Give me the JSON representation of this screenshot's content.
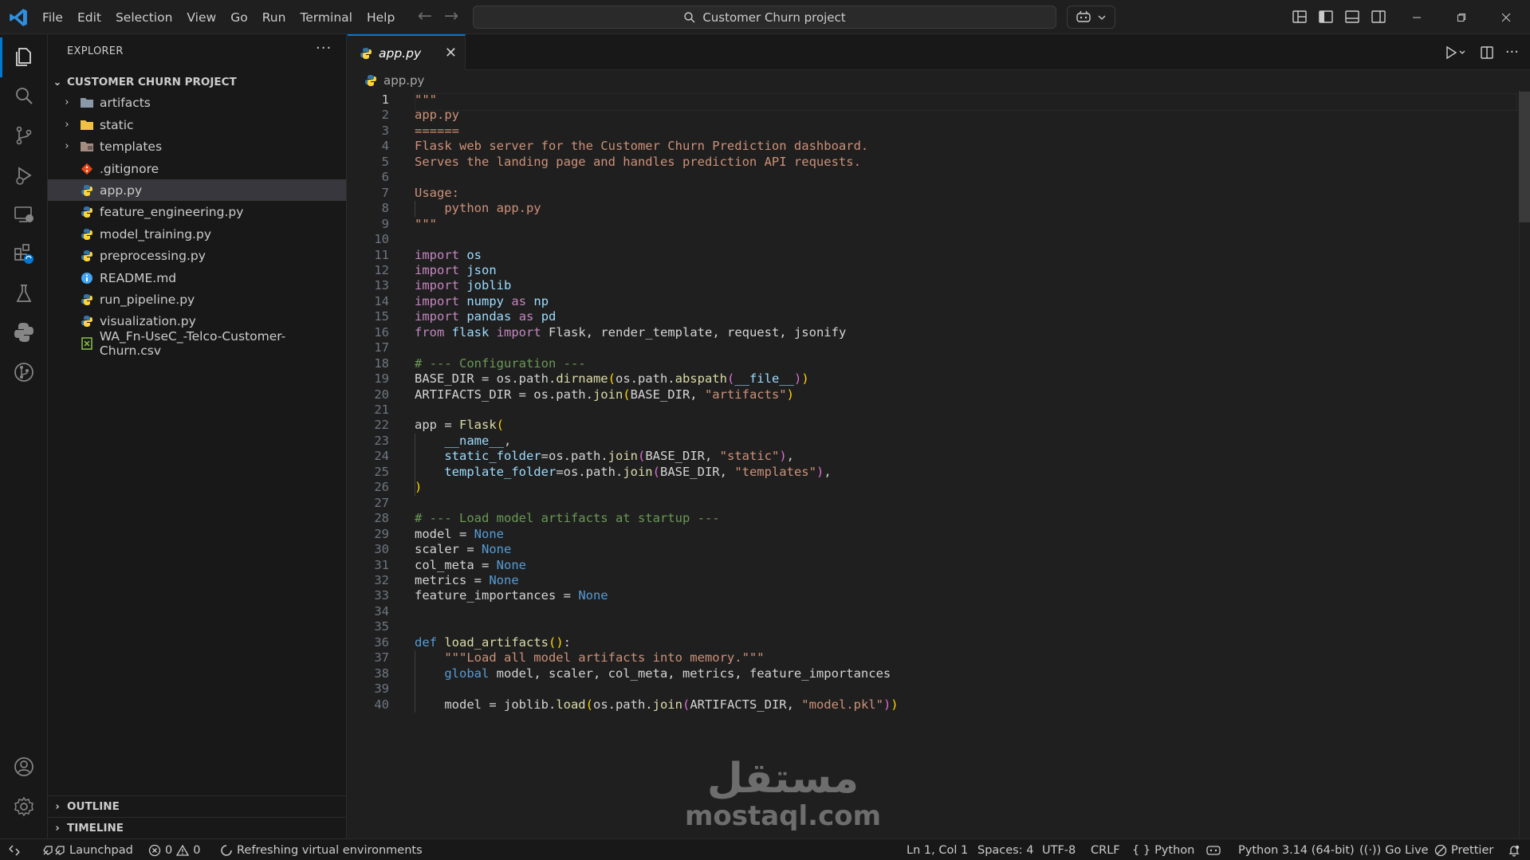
{
  "titlebar": {
    "menu": [
      "File",
      "Edit",
      "Selection",
      "View",
      "Go",
      "Run",
      "Terminal",
      "Help"
    ],
    "search_text": "Customer Churn project"
  },
  "activitybar": {
    "icons": [
      "explorer-icon",
      "search-icon",
      "source-control-icon",
      "run-debug-icon",
      "remote-explorer-icon",
      "extensions-icon",
      "testing-icon",
      "python-icon",
      "git-graph-icon",
      "account-icon",
      "settings-gear-icon"
    ]
  },
  "sidebar": {
    "header": "EXPLORER",
    "more": "···",
    "project": "CUSTOMER CHURN PROJECT",
    "items": [
      {
        "label": "artifacts",
        "type": "folder"
      },
      {
        "label": "static",
        "type": "folder"
      },
      {
        "label": "templates",
        "type": "folder"
      },
      {
        "label": ".gitignore",
        "type": "git"
      },
      {
        "label": "app.py",
        "type": "python",
        "selected": true
      },
      {
        "label": "feature_engineering.py",
        "type": "python"
      },
      {
        "label": "model_training.py",
        "type": "python"
      },
      {
        "label": "preprocessing.py",
        "type": "python"
      },
      {
        "label": "README.md",
        "type": "info"
      },
      {
        "label": "run_pipeline.py",
        "type": "python"
      },
      {
        "label": "visualization.py",
        "type": "python"
      },
      {
        "label": "WA_Fn-UseC_-Telco-Customer-Churn.csv",
        "type": "csv"
      }
    ],
    "outline": "OUTLINE",
    "timeline": "TIMELINE"
  },
  "editor": {
    "tab_label": "app.py",
    "breadcrumb": "app.py",
    "lines": [
      [
        [
          "t-str",
          "\"\"\""
        ]
      ],
      [
        [
          "t-str",
          "app.py"
        ]
      ],
      [
        [
          "t-str",
          "======"
        ]
      ],
      [
        [
          "t-str",
          "Flask web server for the Customer Churn Prediction dashboard."
        ]
      ],
      [
        [
          "t-str",
          "Serves the landing page and handles prediction API requests."
        ]
      ],
      [],
      [
        [
          "t-str",
          "Usage:"
        ]
      ],
      [
        [
          "t-str",
          "    python app.py"
        ]
      ],
      [
        [
          "t-str",
          "\"\"\""
        ]
      ],
      [],
      [
        [
          "t-kw",
          "import"
        ],
        [
          "t-pl",
          " "
        ],
        [
          "t-var",
          "os"
        ]
      ],
      [
        [
          "t-kw",
          "import"
        ],
        [
          "t-pl",
          " "
        ],
        [
          "t-var",
          "json"
        ]
      ],
      [
        [
          "t-kw",
          "import"
        ],
        [
          "t-pl",
          " "
        ],
        [
          "t-var",
          "joblib"
        ]
      ],
      [
        [
          "t-kw",
          "import"
        ],
        [
          "t-pl",
          " "
        ],
        [
          "t-var",
          "numpy"
        ],
        [
          "t-pl",
          " "
        ],
        [
          "t-kw",
          "as"
        ],
        [
          "t-pl",
          " "
        ],
        [
          "t-var",
          "np"
        ]
      ],
      [
        [
          "t-kw",
          "import"
        ],
        [
          "t-pl",
          " "
        ],
        [
          "t-var",
          "pandas"
        ],
        [
          "t-pl",
          " "
        ],
        [
          "t-kw",
          "as"
        ],
        [
          "t-pl",
          " "
        ],
        [
          "t-var",
          "pd"
        ]
      ],
      [
        [
          "t-kw",
          "from"
        ],
        [
          "t-pl",
          " "
        ],
        [
          "t-var",
          "flask"
        ],
        [
          "t-pl",
          " "
        ],
        [
          "t-kw",
          "import"
        ],
        [
          "t-pl",
          " Flask, render_template, request, jsonify"
        ]
      ],
      [],
      [
        [
          "t-cm",
          "# --- Configuration ---"
        ]
      ],
      [
        [
          "t-pl",
          "BASE_DIR = os.path."
        ],
        [
          "t-fn",
          "dirname"
        ],
        [
          "t-br1",
          "("
        ],
        [
          "t-pl",
          "os.path."
        ],
        [
          "t-fn",
          "abspath"
        ],
        [
          "t-br2",
          "("
        ],
        [
          "t-var",
          "__file__"
        ],
        [
          "t-br2",
          ")"
        ],
        [
          "t-br1",
          ")"
        ]
      ],
      [
        [
          "t-pl",
          "ARTIFACTS_DIR = os.path."
        ],
        [
          "t-fn",
          "join"
        ],
        [
          "t-br1",
          "("
        ],
        [
          "t-pl",
          "BASE_DIR, "
        ],
        [
          "t-str",
          "\"artifacts\""
        ],
        [
          "t-br1",
          ")"
        ]
      ],
      [],
      [
        [
          "t-pl",
          "app = "
        ],
        [
          "t-fn",
          "Flask"
        ],
        [
          "t-br1",
          "("
        ]
      ],
      [
        [
          "t-pl",
          "    "
        ],
        [
          "t-var",
          "__name__"
        ],
        [
          "t-pl",
          ","
        ]
      ],
      [
        [
          "t-pl",
          "    "
        ],
        [
          "t-var",
          "static_folder"
        ],
        [
          "t-pl",
          "=os.path."
        ],
        [
          "t-fn",
          "join"
        ],
        [
          "t-br2",
          "("
        ],
        [
          "t-pl",
          "BASE_DIR, "
        ],
        [
          "t-str",
          "\"static\""
        ],
        [
          "t-br2",
          ")"
        ],
        [
          "t-pl",
          ","
        ]
      ],
      [
        [
          "t-pl",
          "    "
        ],
        [
          "t-var",
          "template_folder"
        ],
        [
          "t-pl",
          "=os.path."
        ],
        [
          "t-fn",
          "join"
        ],
        [
          "t-br2",
          "("
        ],
        [
          "t-pl",
          "BASE_DIR, "
        ],
        [
          "t-str",
          "\"templates\""
        ],
        [
          "t-br2",
          ")"
        ],
        [
          "t-pl",
          ","
        ]
      ],
      [
        [
          "t-br1",
          ")"
        ]
      ],
      [],
      [
        [
          "t-cm",
          "# --- Load model artifacts at startup ---"
        ]
      ],
      [
        [
          "t-pl",
          "model = "
        ],
        [
          "t-kw2",
          "None"
        ]
      ],
      [
        [
          "t-pl",
          "scaler = "
        ],
        [
          "t-kw2",
          "None"
        ]
      ],
      [
        [
          "t-pl",
          "col_meta = "
        ],
        [
          "t-kw2",
          "None"
        ]
      ],
      [
        [
          "t-pl",
          "metrics = "
        ],
        [
          "t-kw2",
          "None"
        ]
      ],
      [
        [
          "t-pl",
          "feature_importances = "
        ],
        [
          "t-kw2",
          "None"
        ]
      ],
      [],
      [],
      [
        [
          "t-kw2",
          "def"
        ],
        [
          "t-pl",
          " "
        ],
        [
          "t-fn",
          "load_artifacts"
        ],
        [
          "t-br1",
          "()"
        ],
        [
          "t-pl",
          ":"
        ]
      ],
      [
        [
          "t-pl",
          "    "
        ],
        [
          "t-str",
          "\"\"\"Load all model artifacts into memory.\"\"\""
        ]
      ],
      [
        [
          "t-pl",
          "    "
        ],
        [
          "t-kw2",
          "global"
        ],
        [
          "t-pl",
          " model, scaler, col_meta, metrics, feature_importances"
        ]
      ],
      [],
      [
        [
          "t-pl",
          "    model = joblib."
        ],
        [
          "t-fn",
          "load"
        ],
        [
          "t-br1",
          "("
        ],
        [
          "t-pl",
          "os.path."
        ],
        [
          "t-fn",
          "join"
        ],
        [
          "t-br2",
          "("
        ],
        [
          "t-pl",
          "ARTIFACTS_DIR, "
        ],
        [
          "t-str",
          "\"model.pkl\""
        ],
        [
          "t-br2",
          ")"
        ],
        [
          "t-br1",
          ")"
        ]
      ]
    ]
  },
  "watermark": {
    "arabic": "مستقل",
    "latin": "mostaql.com"
  },
  "statusbar": {
    "launchpad": "Launchpad",
    "errors": "0",
    "warnings": "0",
    "task": "Refreshing virtual environments",
    "position": "Ln 1, Col 1",
    "spaces": "Spaces: 4",
    "encoding": "UTF-8",
    "eol": "CRLF",
    "language": "Python",
    "interpreter": "Python 3.14 (64-bit)",
    "golive": "Go Live",
    "prettier": "Prettier"
  }
}
